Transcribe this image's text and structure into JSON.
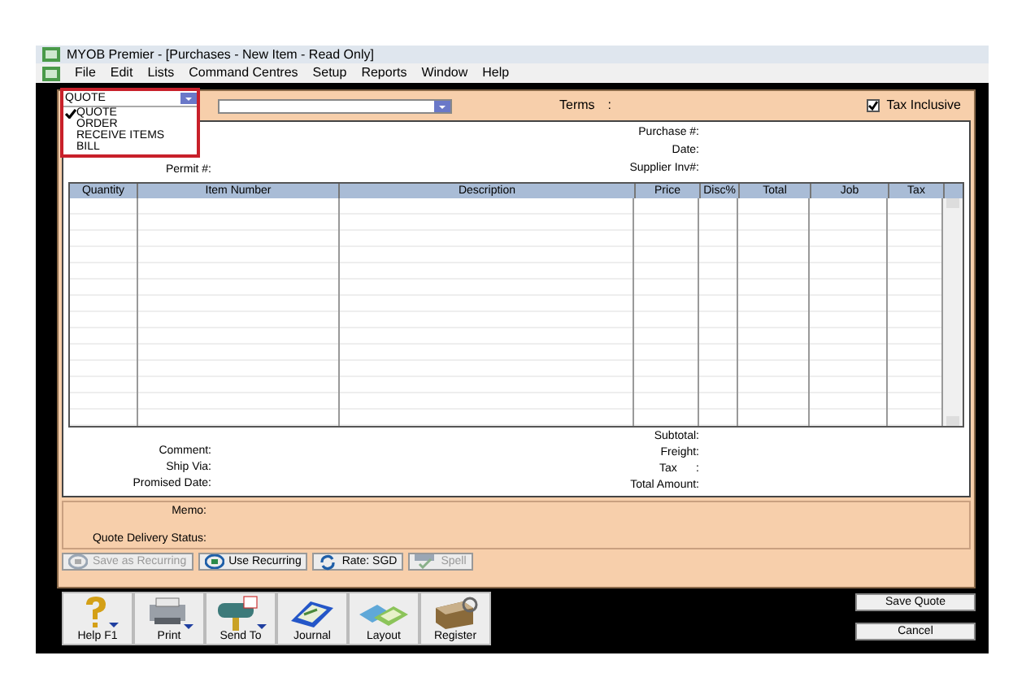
{
  "window": {
    "title": "MYOB Premier - [Purchases - New Item - Read Only]"
  },
  "menu": [
    "File",
    "Edit",
    "Lists",
    "Command Centres",
    "Setup",
    "Reports",
    "Window",
    "Help"
  ],
  "layout_combo": {
    "value": "QUOTE",
    "options": [
      {
        "label": "QUOTE",
        "selected": true
      },
      {
        "label": "ORDER",
        "selected": false
      },
      {
        "label": "RECEIVE ITEMS",
        "selected": false
      },
      {
        "label": "BILL",
        "selected": false
      }
    ]
  },
  "terms_label": "Terms",
  "terms_colon": ":",
  "tax_inclusive": {
    "label": "Tax Inclusive",
    "checked": true
  },
  "header_left": [
    "Permit #:"
  ],
  "header_right": [
    "Purchase #:",
    "Date:",
    "Supplier Inv#:"
  ],
  "table": {
    "columns": [
      "Quantity",
      "Item Number",
      "Description",
      "Price",
      "Disc%",
      "Total",
      "Job",
      "Tax"
    ]
  },
  "footer_left": [
    "Comment:",
    "Ship Via:",
    "Promised Date:"
  ],
  "footer_right": [
    "Subtotal:",
    "Freight:",
    "Tax      :",
    "Total Amount:"
  ],
  "memo_labels": [
    "Memo:",
    "Quote Delivery Status:"
  ],
  "action_buttons": [
    {
      "label": "Save as Recurring",
      "disabled": true,
      "kind": "recurring"
    },
    {
      "label": "Use Recurring",
      "disabled": false,
      "kind": "recurring"
    },
    {
      "label": "Rate:  SGD",
      "disabled": false,
      "kind": "rate"
    },
    {
      "label": "Spell",
      "disabled": true,
      "kind": "spell"
    }
  ],
  "toolbar": [
    {
      "label": "Help F1",
      "kind": "help"
    },
    {
      "label": "Print",
      "kind": "print"
    },
    {
      "label": "Send To",
      "kind": "send"
    },
    {
      "label": "Journal",
      "kind": "journal"
    },
    {
      "label": "Layout",
      "kind": "layout"
    },
    {
      "label": "Register",
      "kind": "register"
    }
  ],
  "buttons": [
    "Save Quote",
    "Cancel"
  ]
}
